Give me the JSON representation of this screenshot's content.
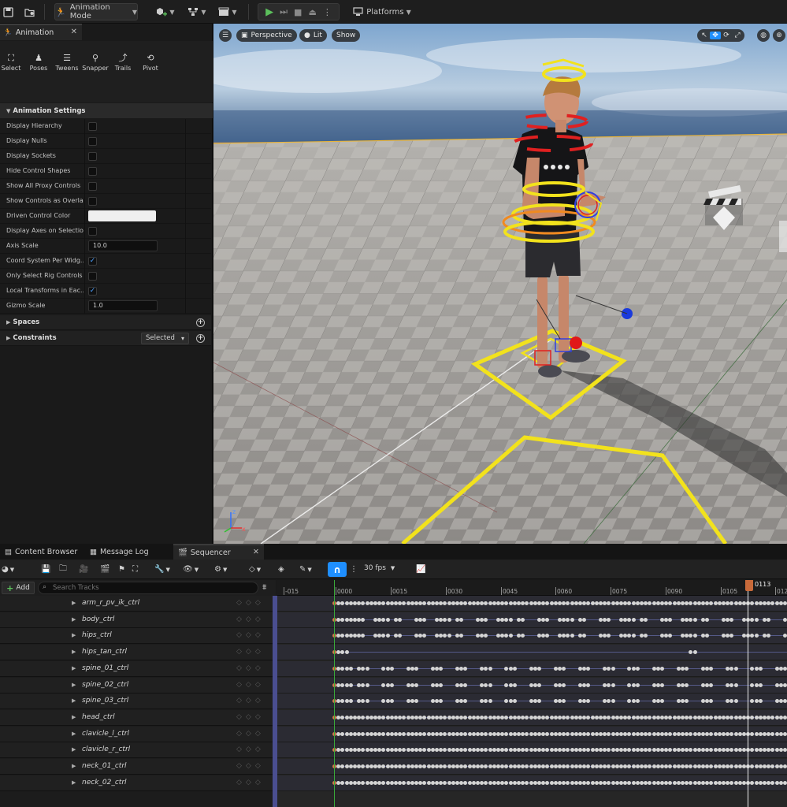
{
  "toolbar": {
    "mode_label": "Animation Mode",
    "platforms_label": "Platforms"
  },
  "left_panel": {
    "tab_title": "Animation",
    "tools": [
      {
        "label": "Select",
        "icon": "select-icon"
      },
      {
        "label": "Poses",
        "icon": "poses-icon"
      },
      {
        "label": "Tweens",
        "icon": "tweens-icon"
      },
      {
        "label": "Snapper",
        "icon": "snapper-icon"
      },
      {
        "label": "Trails",
        "icon": "trails-icon"
      },
      {
        "label": "Pivot",
        "icon": "pivot-icon"
      }
    ],
    "settings_title": "Animation Settings",
    "settings": [
      {
        "label": "Display Hierarchy",
        "type": "checkbox",
        "checked": false
      },
      {
        "label": "Display Nulls",
        "type": "checkbox",
        "checked": false
      },
      {
        "label": "Display Sockets",
        "type": "checkbox",
        "checked": false
      },
      {
        "label": "Hide Control Shapes",
        "type": "checkbox",
        "checked": false
      },
      {
        "label": "Show All Proxy Controls",
        "type": "checkbox",
        "checked": false
      },
      {
        "label": "Show Controls as Overlay",
        "type": "checkbox",
        "checked": false
      },
      {
        "label": "Driven Control Color",
        "type": "color",
        "value": "#efefef"
      },
      {
        "label": "Display Axes on Selection",
        "type": "checkbox",
        "checked": false
      },
      {
        "label": "Axis Scale",
        "type": "number",
        "value": "10.0"
      },
      {
        "label": "Coord System Per Widg...",
        "type": "checkbox",
        "checked": true
      },
      {
        "label": "Only Select Rig Controls",
        "type": "checkbox",
        "checked": false
      },
      {
        "label": "Local Transforms in Eac...",
        "type": "checkbox",
        "checked": true
      },
      {
        "label": "Gizmo Scale",
        "type": "number",
        "value": "1.0"
      }
    ],
    "spaces_label": "Spaces",
    "constraints_label": "Constraints",
    "constraints_filter": "Selected"
  },
  "viewport": {
    "perspective_label": "Perspective",
    "lit_label": "Lit",
    "show_label": "Show"
  },
  "bottom": {
    "tabs": [
      "Content Browser",
      "Message Log",
      "Sequencer"
    ],
    "fps_label": "30 fps",
    "add_label": "Add",
    "search_placeholder": "Search Tracks",
    "ruler_ticks": [
      "-015",
      "0000",
      "0015",
      "0030",
      "0045",
      "0060",
      "0075",
      "0090",
      "0105",
      "012"
    ],
    "playhead_frame": "0113",
    "tracks": [
      {
        "name": "arm_r_pv_ik_ctrl",
        "pattern": "dense"
      },
      {
        "name": "body_ctrl",
        "pattern": "sparse"
      },
      {
        "name": "hips_ctrl",
        "pattern": "sparse"
      },
      {
        "name": "hips_tan_ctrl",
        "pattern": "minimal"
      },
      {
        "name": "spine_01_ctrl",
        "pattern": "medium"
      },
      {
        "name": "spine_02_ctrl",
        "pattern": "medium"
      },
      {
        "name": "spine_03_ctrl",
        "pattern": "medium"
      },
      {
        "name": "head_ctrl",
        "pattern": "dense"
      },
      {
        "name": "clavicle_l_ctrl",
        "pattern": "dense"
      },
      {
        "name": "clavicle_r_ctrl",
        "pattern": "dense"
      },
      {
        "name": "neck_01_ctrl",
        "pattern": "dense"
      },
      {
        "name": "neck_02_ctrl",
        "pattern": "dense"
      }
    ]
  },
  "colors": {
    "accent": "#1f8fff",
    "playhead": "#c86a3a",
    "gizmo_yellow": "#f2e21c"
  }
}
